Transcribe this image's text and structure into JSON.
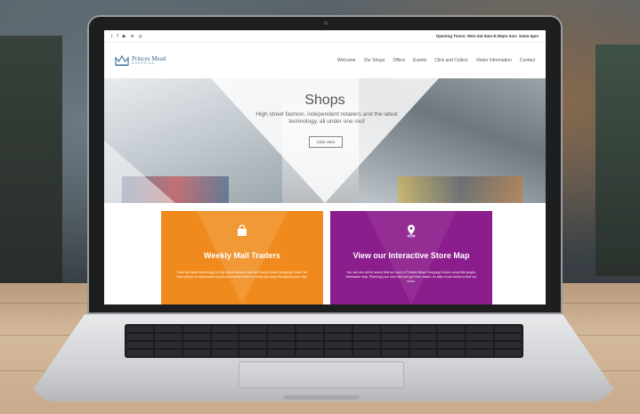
{
  "website": {
    "topbar": {
      "social_icons": [
        "twitter-icon",
        "facebook-icon",
        "youtube-icon",
        "linkedin-icon",
        "instagram-icon"
      ],
      "info_text": "Opening Times: Mon-Sat 9am-5:30pm Sun: 10am-4pm"
    },
    "logo": {
      "name": "Princes Mead",
      "sub": "SHOPPING"
    },
    "nav": [
      "Welcome",
      "Our Shops",
      "Offers",
      "Events",
      "Click and Collect",
      "Visitor Information",
      "Contact"
    ],
    "hero": {
      "title": "Shops",
      "subtitle": "High street fashion, independent retailers and the latest technology, all under one roof",
      "button": "Click Here"
    },
    "cards": [
      {
        "title": "Weekly Mall Traders",
        "text": "From the latest technology to high street fashion, here at Princes Mead Shopping Centre we have plenty of independent shops and market sellers to keep you busy throughout your visit.",
        "color": "#f08a1c",
        "icon": "shopping-bag-icon"
      },
      {
        "title": "View our Interactive Store Map",
        "text": "You can see all the stores that we have in Princes Mead Shopping Centre using this simple, interactive map. Planning your next visit just got even easier, so take a look below to find out more.",
        "color": "#8b1d8c",
        "icon": "map-pin-icon"
      }
    ]
  }
}
